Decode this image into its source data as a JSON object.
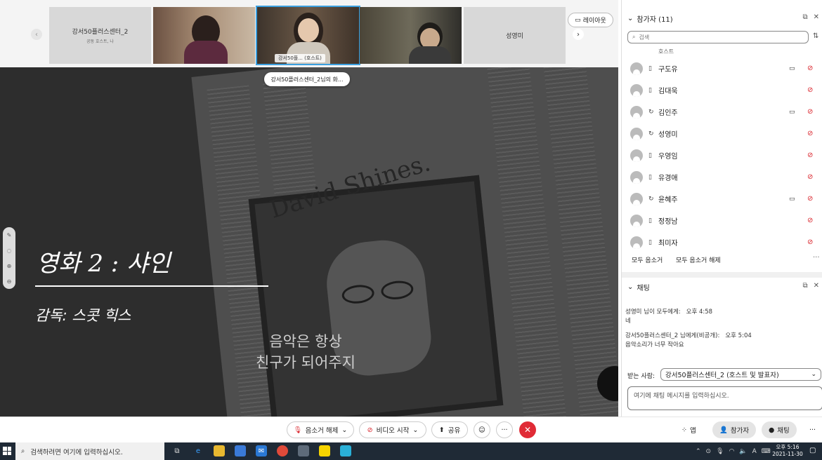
{
  "top_strip": {
    "nav_prev": "‹",
    "nav_next": "›",
    "tiles": [
      {
        "name": "강서50플러스센터_2",
        "subtitle": "공동 호스트, 나"
      },
      {
        "name": ""
      },
      {
        "name": "강서50플... (호스트)"
      },
      {
        "name": ""
      },
      {
        "name": "성영미"
      }
    ],
    "layout_button": "레이아웃"
  },
  "share": {
    "sharer_pill": "강서50플러스센터_2님의 화...",
    "headline": "David Shines.",
    "slide_title": "영화 2 : 샤인",
    "slide_subtitle": "감독: 스콧 힉스",
    "caption_line1": "음악은 항상",
    "caption_line2": "친구가 되어주지"
  },
  "participants": {
    "title": "참가자 (11)",
    "search_placeholder": "검색",
    "partial_label": "호스트",
    "list": [
      {
        "name": "구도유",
        "device": "phone",
        "camera": true
      },
      {
        "name": "김대욱",
        "device": "phone",
        "camera": false
      },
      {
        "name": "김인주",
        "device": "sync",
        "camera": true
      },
      {
        "name": "성영미",
        "device": "sync",
        "camera": false
      },
      {
        "name": "우영임",
        "device": "phone",
        "camera": false
      },
      {
        "name": "유경애",
        "device": "phone",
        "camera": false
      },
      {
        "name": "윤혜주",
        "device": "sync",
        "camera": true
      },
      {
        "name": "정정남",
        "device": "phone",
        "camera": false
      },
      {
        "name": "최미자",
        "device": "phone",
        "camera": false
      }
    ],
    "mute_all": "모두 음소거",
    "unmute_all": "모두 음소거 해제"
  },
  "chat": {
    "title": "채팅",
    "messages": [
      {
        "from": "성영미 님이 모두에게:",
        "time": "오후 4:58",
        "text": "네"
      },
      {
        "from": "강서50플러스센터_2 님에게(비공개):",
        "time": "오후 5:04",
        "text": "음악소리가 너무 작아요"
      }
    ],
    "to_label": "받는 사람:",
    "to_value": "강서50플러스센터_2 (호스트 및 발표자)",
    "input_placeholder": "여기에 채팅 메시지를 입력하십시오."
  },
  "toolbar": {
    "unmute": "음소거 해제",
    "start_video": "비디오 시작",
    "share": "공유",
    "more": "···",
    "end": "✕",
    "apps": "앱",
    "participants": "참가자",
    "chat": "채팅"
  },
  "taskbar": {
    "search_placeholder": "검색하려면 여기에 입력하십시오.",
    "ime": "A",
    "time": "오후 5:16",
    "date": "2021-11-30"
  },
  "colors": {
    "accent": "#3ba0e0",
    "danger": "#e02b36",
    "share_bg": "#2d2d2d",
    "taskbar": "#1f2a36"
  }
}
